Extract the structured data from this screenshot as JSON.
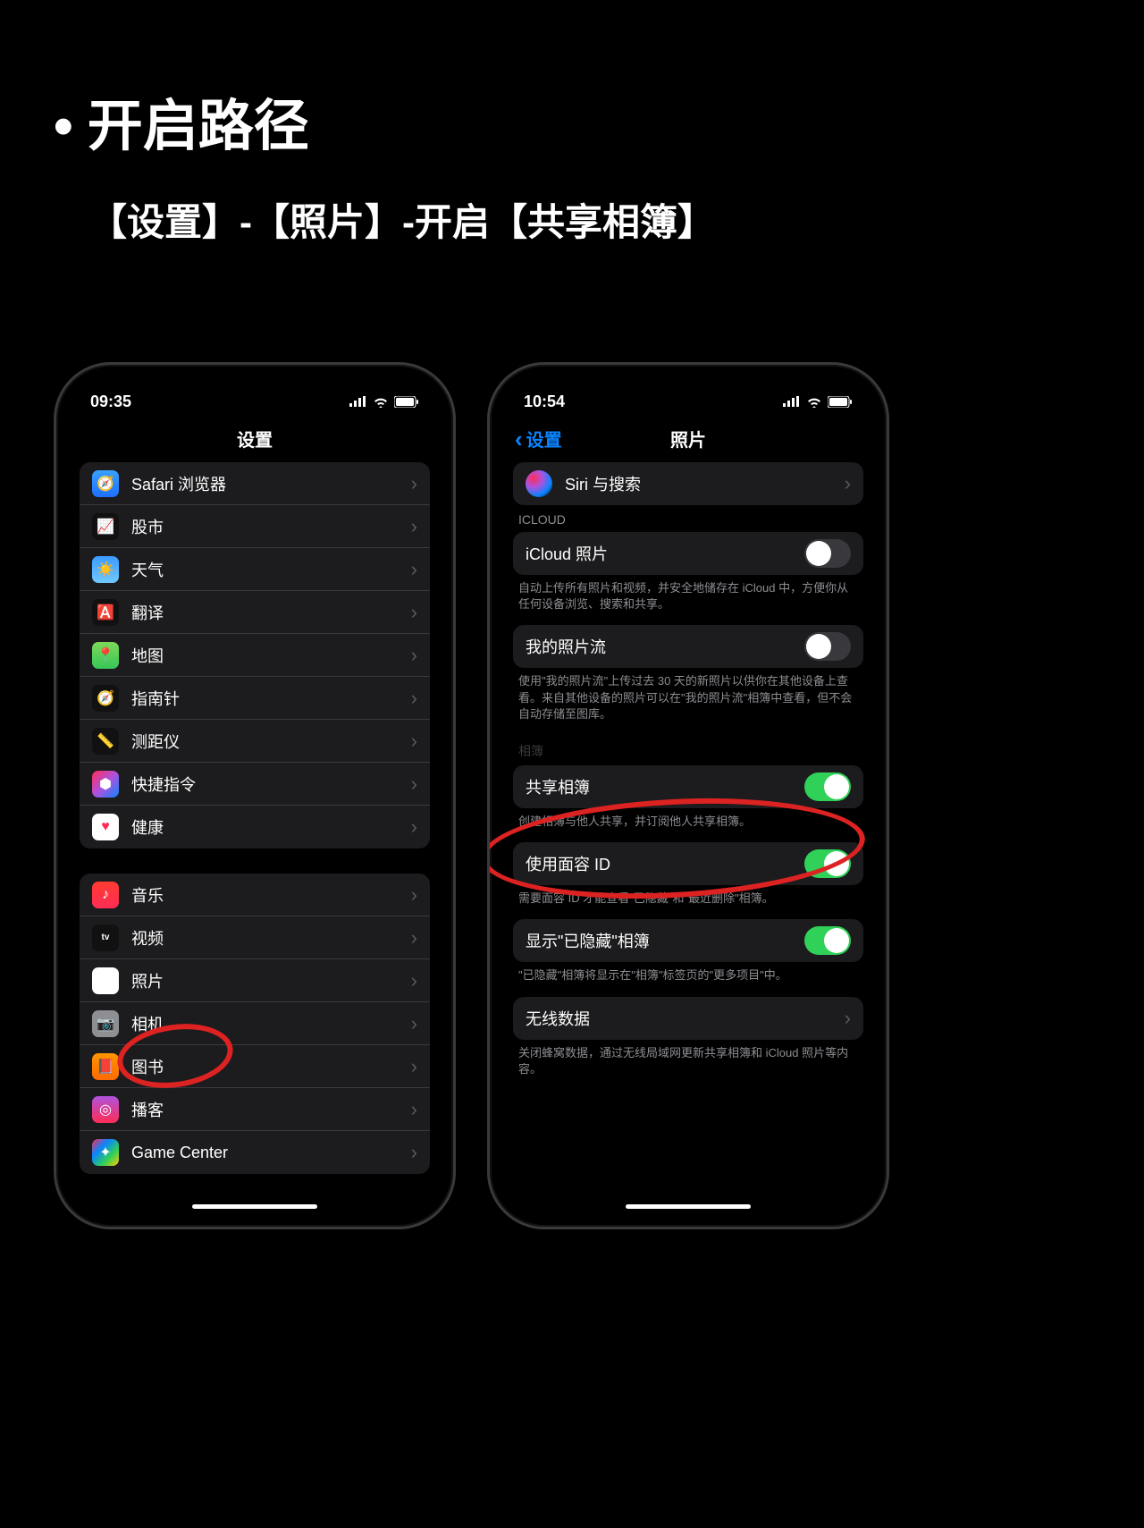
{
  "heading": "开启路径",
  "subheading": "【设置】-【照片】-开启【共享相簿】",
  "left": {
    "time": "09:35",
    "title": "设置",
    "group1": [
      {
        "icon": "safari",
        "label": "Safari 浏览器"
      },
      {
        "icon": "stocks",
        "label": "股市"
      },
      {
        "icon": "weather",
        "label": "天气"
      },
      {
        "icon": "translate",
        "label": "翻译"
      },
      {
        "icon": "maps",
        "label": "地图"
      },
      {
        "icon": "compass",
        "label": "指南针"
      },
      {
        "icon": "measure",
        "label": "测距仪"
      },
      {
        "icon": "shortcuts",
        "label": "快捷指令"
      },
      {
        "icon": "health",
        "label": "健康"
      }
    ],
    "group2": [
      {
        "icon": "music",
        "label": "音乐"
      },
      {
        "icon": "tv",
        "label": "视频"
      },
      {
        "icon": "photos",
        "label": "照片"
      },
      {
        "icon": "camera",
        "label": "相机"
      },
      {
        "icon": "books",
        "label": "图书"
      },
      {
        "icon": "podcasts",
        "label": "播客"
      },
      {
        "icon": "gamecenter",
        "label": "Game Center"
      }
    ]
  },
  "right": {
    "time": "10:54",
    "back": "设置",
    "title": "照片",
    "siri_row": {
      "label": "Siri 与搜索"
    },
    "icloud_header": "ICLOUD",
    "icloud_photos": {
      "label": "iCloud 照片",
      "on": false
    },
    "icloud_footer": "自动上传所有照片和视频，并安全地储存在 iCloud 中，方便你从任何设备浏览、搜索和共享。",
    "photostream": {
      "label": "我的照片流",
      "on": false
    },
    "photostream_footer": "使用\"我的照片流\"上传过去 30 天的新照片以供你在其他设备上查看。来自其他设备的照片可以在\"我的照片流\"相簿中查看，但不会自动存储至图库。",
    "albums_header": "相簿",
    "shared_album": {
      "label": "共享相簿",
      "on": true
    },
    "shared_footer": "创建相簿与他人共享，并订阅他人共享相簿。",
    "faceid": {
      "label": "使用面容 ID",
      "on": true
    },
    "faceid_footer": "需要面容 ID 才能查看\"已隐藏\"和\"最近删除\"相簿。",
    "hidden": {
      "label": "显示\"已隐藏\"相簿",
      "on": true
    },
    "hidden_footer": "\"已隐藏\"相簿将显示在\"相簿\"标签页的\"更多项目\"中。",
    "cellular": {
      "label": "无线数据"
    },
    "cellular_footer": "关闭蜂窝数据，通过无线局域网更新共享相簿和 iCloud 照片等内容。"
  }
}
